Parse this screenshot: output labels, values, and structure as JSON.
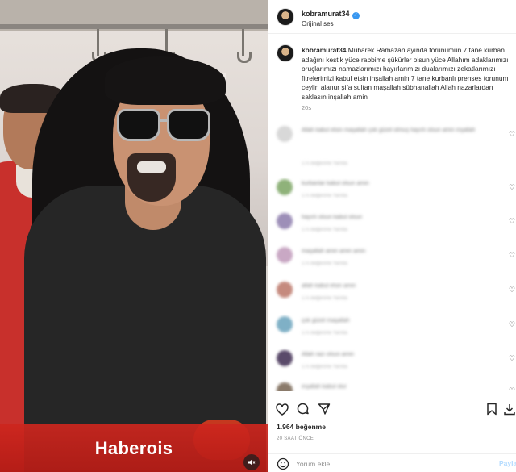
{
  "media": {
    "watermark": "Haberois",
    "mute_icon": "speaker-muted-icon"
  },
  "header": {
    "username": "kobramurat34",
    "audio_label": "Orijinal ses"
  },
  "caption": {
    "username": "kobramurat34",
    "text": "Mübarek Ramazan ayında torunumun 7 tane kurban adağını kestik yüce rabbime şükürler olsun yüce Allahım adaklarımızı oruçlarımızı namazlarımızı hayırlarımızı dualarımızı zekatlarımızı fitrelerimizi kabul etsin inşallah amin 7 tane kurbanlı prenses torunum ceylin alanur şifa sultan maşallah sübhanallah Allah nazarlardan saklasın inşallah amin",
    "time": "20s"
  },
  "comments": [
    {
      "text": "Allah kabul etsin maşallah çok güzel olmuş hayırlı olsun amin inşallah",
      "meta": "17s  Beğenme  Yanıtla"
    },
    {
      "text": "kurbanlar kabul olsun amin",
      "meta": "17s  Beğenme  Yanıtla"
    },
    {
      "text": "hayırlı olsun kabul olsun",
      "meta": "17s  Beğenme  Yanıtla"
    },
    {
      "text": "maşallah amin amin amin",
      "meta": "17s  Beğenme  Yanıtla"
    },
    {
      "text": "allah kabul etsin amin",
      "meta": "17s  Beğenme  Yanıtla"
    },
    {
      "text": "çok güzel maşallah",
      "meta": "17s  Beğenme  Yanıtla"
    },
    {
      "text": "Allah razı olsun amin",
      "meta": "17s  Beğenme  Yanıtla"
    },
    {
      "text": "inşallah kabul olur",
      "meta": "17s  Beğenme  Yanıtla"
    }
  ],
  "stats": {
    "likes": "1.964 beğenme",
    "date": "20 SAAT ÖNCE"
  },
  "add_comment": {
    "placeholder": "Yorum ekle...",
    "post_label": "Paylaş"
  },
  "colors": {
    "verified": "#3897f0",
    "watermark": "#cd261e",
    "muted_text": "#8e8e8e"
  }
}
